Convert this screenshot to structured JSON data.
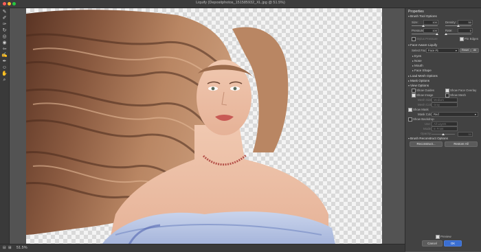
{
  "window": {
    "title": "Liquify (Depositphotos_151585932_XL.jpg @ 51.5%)"
  },
  "toolbar": {
    "tools": [
      "forward-warp",
      "reconstruct",
      "smooth",
      "twirl",
      "pucker",
      "bloat",
      "push-left",
      "freeze-mask",
      "thaw-mask",
      "face",
      "hand",
      "zoom"
    ]
  },
  "status": {
    "zoom": "51.5%"
  },
  "panel": {
    "title": "Properties",
    "brush_tool": {
      "header": "Brush Tool Options",
      "size_label": "Size:",
      "size_value": "100",
      "density_label": "Density:",
      "density_value": "50",
      "pressure_label": "Pressure:",
      "pressure_value": "100",
      "rate_label": "Rate:",
      "rate_value": "0",
      "stylus_label": "Stylus Pressure",
      "pin_edges_label": "Pin Edges"
    },
    "face_aware": {
      "header": "Face-Aware Liquify",
      "select_face_label": "Select Face:",
      "select_face_value": "Face #1",
      "reset_label": "Reset",
      "all_label": "All",
      "items": [
        "Eyes",
        "Nose",
        "Mouth",
        "Face Shape"
      ]
    },
    "load_mesh": {
      "header": "Load Mesh Options"
    },
    "mask_options": {
      "header": "Mask Options"
    },
    "view_options": {
      "header": "View Options",
      "show_guides": "Show Guides",
      "show_face_overlay": "Show Face Overlay",
      "show_image": "Show Image",
      "show_mesh": "Show Mesh",
      "mesh_size_label": "Mesh Size:",
      "mesh_size_value": "Medium",
      "mesh_color_label": "Mesh Color:",
      "mesh_color_value": "Gray"
    },
    "mask": {
      "show_mask": "Show Mask",
      "mask_color_label": "Mask Color:",
      "mask_color_value": "Red"
    },
    "backdrop": {
      "show_backdrop": "Show Backdrop",
      "use_label": "Use:",
      "use_value": "All Layers",
      "mode_label": "Mode:",
      "mode_value": "In Front",
      "opacity_label": "Opacity:",
      "opacity_value": "50"
    },
    "reconstruct": {
      "header": "Brush Reconstruct Options",
      "reconstruct_button": "Reconstruct...",
      "restore_button": "Restore All"
    },
    "preview_label": "Preview",
    "cancel_button": "Cancel",
    "ok_button": "OK"
  },
  "colors": {
    "accent": "#3a6ed1",
    "panel_bg": "#424242",
    "canvas_bg": "#535353"
  }
}
